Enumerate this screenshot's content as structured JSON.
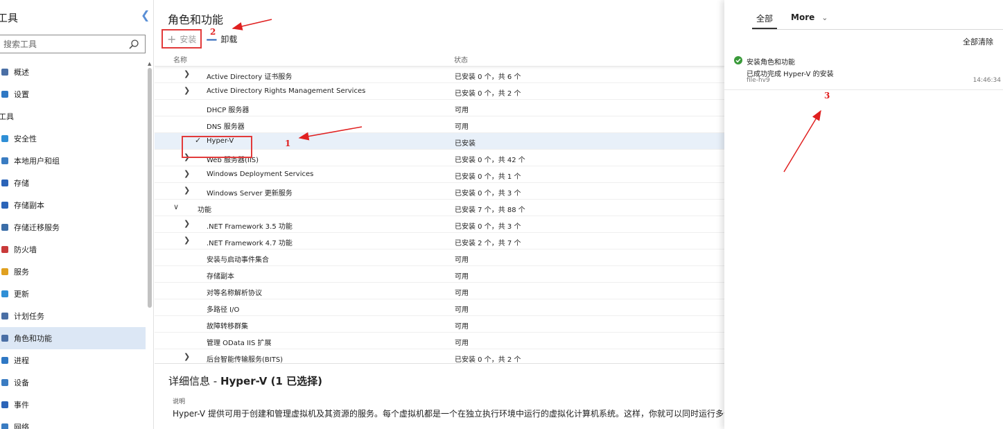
{
  "sidebar": {
    "title": "工具",
    "search_placeholder": "搜索工具",
    "items": [
      {
        "label": "概述",
        "color": "#4a6fa5"
      },
      {
        "label": "设置",
        "color": "#2f78c4"
      },
      {
        "group": "工具"
      },
      {
        "label": "安全性",
        "color": "#2f8fd6"
      },
      {
        "label": "本地用户和组",
        "color": "#3a7cc2"
      },
      {
        "label": "存储",
        "color": "#2b64b8"
      },
      {
        "label": "存储副本",
        "color": "#2b64b8"
      },
      {
        "label": "存储迁移服务",
        "color": "#3b6ea8"
      },
      {
        "label": "防火墙",
        "color": "#c93a3a"
      },
      {
        "label": "服务",
        "color": "#e0a020"
      },
      {
        "label": "更新",
        "color": "#2f8fd6"
      },
      {
        "label": "计划任务",
        "color": "#4a6fa5"
      },
      {
        "label": "角色和功能",
        "color": "#4a6fa5",
        "active": true
      },
      {
        "label": "进程",
        "color": "#2f78c4"
      },
      {
        "label": "设备",
        "color": "#3a7cc2"
      },
      {
        "label": "事件",
        "color": "#2b64b8"
      },
      {
        "label": "网络",
        "color": "#3a7cc2"
      }
    ]
  },
  "main": {
    "title": "角色和功能",
    "toolbar": {
      "install": "安装",
      "uninstall": "卸载"
    },
    "columns": {
      "name": "名称",
      "status": "状态"
    },
    "rows": [
      {
        "name": "Active Directory 证书服务",
        "status": "已安装 0 个，共 6 个",
        "indent": 1,
        "expand": true
      },
      {
        "name": "Active Directory Rights Management Services",
        "status": "已安装 0 个，共 2 个",
        "indent": 1,
        "expand": true
      },
      {
        "name": "DHCP 服务器",
        "status": "可用",
        "indent": 1
      },
      {
        "name": "DNS 服务器",
        "status": "可用",
        "indent": 1
      },
      {
        "name": "Hyper-V",
        "status": "已安装",
        "indent": 1,
        "checked": true,
        "selected": true
      },
      {
        "name": "Web 服务器(IIS)",
        "status": "已安装 0 个，共 42 个",
        "indent": 1,
        "expand": true
      },
      {
        "name": "Windows Deployment Services",
        "status": "已安装 0 个，共 1 个",
        "indent": 1,
        "expand": true
      },
      {
        "name": "Windows Server 更新服务",
        "status": "已安装 0 个，共 3 个",
        "indent": 1,
        "expand": true
      },
      {
        "name": "功能",
        "status": "已安装 7 个，共 88 个",
        "indent": 0,
        "expanded": true
      },
      {
        "name": ".NET Framework 3.5 功能",
        "status": "已安装 0 个，共 3 个",
        "indent": 1,
        "expand": true
      },
      {
        "name": ".NET Framework 4.7 功能",
        "status": "已安装 2 个，共 7 个",
        "indent": 1,
        "expand": true
      },
      {
        "name": "安装与启动事件集合",
        "status": "可用",
        "indent": 1
      },
      {
        "name": "存储副本",
        "status": "可用",
        "indent": 1
      },
      {
        "name": "对等名称解析协议",
        "status": "可用",
        "indent": 1
      },
      {
        "name": "多路径 I/O",
        "status": "可用",
        "indent": 1
      },
      {
        "name": "故障转移群集",
        "status": "可用",
        "indent": 1
      },
      {
        "name": "管理 OData IIS 扩展",
        "status": "可用",
        "indent": 1
      },
      {
        "name": "后台智能传输服务(BITS)",
        "status": "已安装 0 个，共 2 个",
        "indent": 1,
        "expand": true
      }
    ],
    "details": {
      "title_prefix": "详细信息 - ",
      "title_name": "Hyper-V",
      "title_count": "(1 已选择)",
      "label": "说明",
      "text": "Hyper-V 提供可用于创建和管理虚拟机及其资源的服务。每个虚拟机都是一个在独立执行环境中运行的虚拟化计算机系统。这样，你就可以同时运行多个操作系统。"
    }
  },
  "notifications": {
    "tabs": {
      "all": "全部",
      "more": "More"
    },
    "clear_all": "全部清除",
    "item": {
      "title": "安装角色和功能",
      "message": "已成功完成 Hyper-V 的安装",
      "source": "file-hv9",
      "time": "14:46:34"
    }
  },
  "annotations": {
    "n1": "1",
    "n2": "2",
    "n3": "3"
  },
  "colors": {
    "accent": "#2b64b8",
    "annotation": "#e02020",
    "selected_row": "#e8f0f9",
    "success": "#3a9a3a"
  }
}
